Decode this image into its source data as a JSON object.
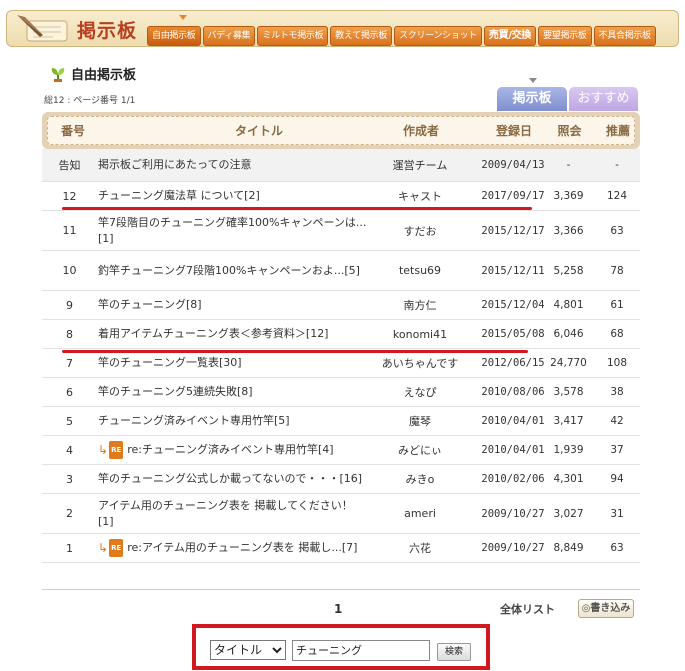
{
  "brand": {
    "title": "掲示板"
  },
  "nav": {
    "tabs": [
      {
        "label": "自由掲示板"
      },
      {
        "label": "バディ募集"
      },
      {
        "label": "ミルトモ掲示板"
      },
      {
        "label": "教えて掲示板"
      },
      {
        "label": "スクリーンショット"
      },
      {
        "label": "売買/交換"
      },
      {
        "label": "要望掲示板"
      },
      {
        "label": "不具合掲示板"
      }
    ]
  },
  "board": {
    "title": "自由掲示板",
    "summary": "総12 : ページ番号 1/1",
    "view_tabs": {
      "board": "掲示板",
      "recommended": "おすすめ"
    }
  },
  "table": {
    "headers": {
      "number": "番号",
      "title": "タイトル",
      "author": "作成者",
      "date": "登録日",
      "views": "照会",
      "votes": "推薦"
    },
    "rows": [
      {
        "number": "告知",
        "title": "掲示板ご利用にあたっての注意",
        "author": "運営チーム",
        "date": "2009/04/13",
        "views": "-",
        "votes": "-"
      },
      {
        "number": "12",
        "title": "チューニング魔法草 について[2]",
        "author": "キャスト",
        "date": "2017/09/17",
        "views": "3,369",
        "votes": "124"
      },
      {
        "number": "11",
        "title": "竿7段階目のチューニング確率100%キャンペーンは...[1]",
        "author": "すだお",
        "date": "2015/12/17",
        "views": "3,366",
        "votes": "63"
      },
      {
        "number": "10",
        "title": "釣竿チューニング7段階100%キャンペーンおよ...[5]",
        "author": "tetsu69",
        "date": "2015/12/11",
        "views": "5,258",
        "votes": "78"
      },
      {
        "number": "9",
        "title": "竿のチューニング[8]",
        "author": "南方仁",
        "date": "2015/12/04",
        "views": "4,801",
        "votes": "61"
      },
      {
        "number": "8",
        "title": "着用アイテムチューニング表＜参考資料＞[12]",
        "author": "konomi41",
        "date": "2015/05/08",
        "views": "6,046",
        "votes": "68"
      },
      {
        "number": "7",
        "title": "竿のチューニング一覧表[30]",
        "author": "あいちゃんです",
        "date": "2012/06/15",
        "views": "24,770",
        "votes": "108"
      },
      {
        "number": "6",
        "title": "竿のチューニング5連続失敗[8]",
        "author": "えなぴ",
        "date": "2010/08/06",
        "views": "3,578",
        "votes": "38"
      },
      {
        "number": "5",
        "title": "チューニング済みイベント専用竹竿[5]",
        "author": "魔琴",
        "date": "2010/04/01",
        "views": "3,417",
        "votes": "42"
      },
      {
        "number": "4",
        "title": "re:チューニング済みイベント専用竹竿[4]",
        "author": "みどにぃ",
        "date": "2010/04/01",
        "views": "1,939",
        "votes": "37",
        "reply_badge": "RE"
      },
      {
        "number": "3",
        "title": "竿のチューニング公式しか載ってないので・・・[16]",
        "author": "みきo",
        "date": "2010/02/06",
        "views": "4,301",
        "votes": "94"
      },
      {
        "number": "2",
        "title": "アイテム用のチューニング表を 掲載してください！[1]",
        "author": "ameri",
        "date": "2009/10/27",
        "views": "3,027",
        "votes": "31"
      },
      {
        "number": "1",
        "title": "re:アイテム用のチューニング表を 掲載し...[7]",
        "author": "六花",
        "date": "2009/10/27",
        "views": "8,849",
        "votes": "63",
        "reply_badge": "RE"
      }
    ]
  },
  "footer": {
    "page": "1",
    "all_list": "全体リスト",
    "write_button": "◎書き込み"
  },
  "search": {
    "field_selected": "タイトル",
    "query": "チューニング",
    "button_label": "検索"
  },
  "colors": {
    "accent_orange": "#d9701c",
    "highlight_red": "#d11820",
    "brand_text": "#b73f1e"
  }
}
